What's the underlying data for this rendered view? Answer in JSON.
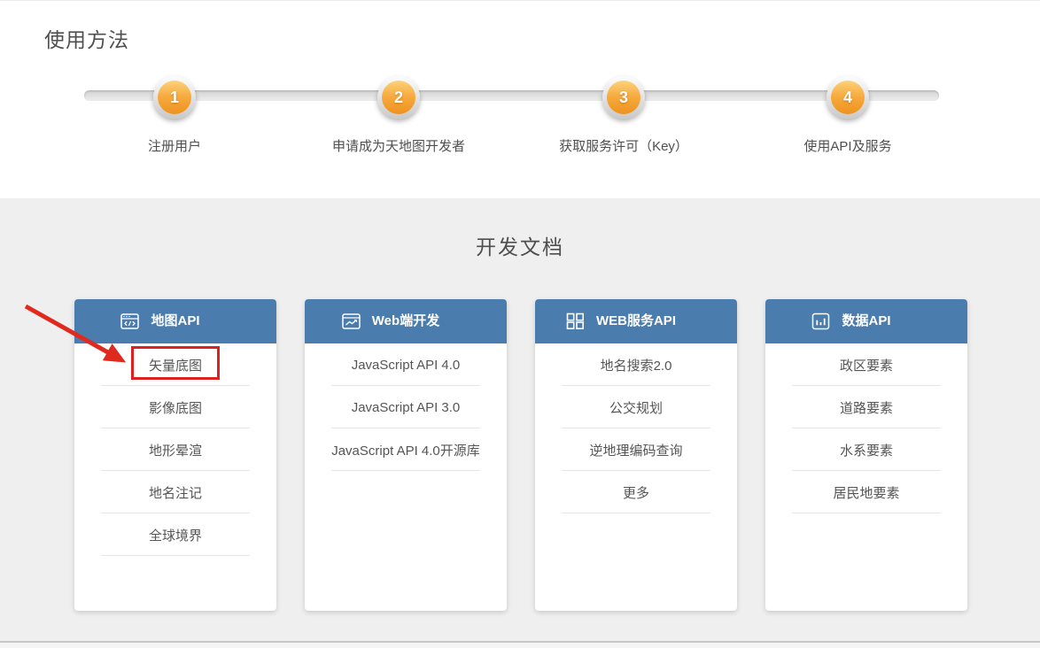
{
  "usage": {
    "title": "使用方法",
    "steps": [
      {
        "number": "1",
        "label": "注册用户"
      },
      {
        "number": "2",
        "label": "申请成为天地图开发者"
      },
      {
        "number": "3",
        "label": "获取服务许可（Key）"
      },
      {
        "number": "4",
        "label": "使用API及服务"
      }
    ]
  },
  "docs": {
    "title": "开发文档",
    "cards": [
      {
        "icon": "code-window-icon",
        "title": "地图API",
        "items": [
          "矢量底图",
          "影像底图",
          "地形晕渲",
          "地名注记",
          "全球境界"
        ],
        "highlighted_item": "矢量底图"
      },
      {
        "icon": "chart-window-icon",
        "title": "Web端开发",
        "items": [
          "JavaScript API 4.0",
          "JavaScript API 3.0",
          "JavaScript API 4.0开源库"
        ]
      },
      {
        "icon": "grid-icon",
        "title": "WEB服务API",
        "items": [
          "地名搜索2.0",
          "公交规划",
          "逆地理编码查询",
          "更多"
        ]
      },
      {
        "icon": "bar-chart-icon",
        "title": "数据API",
        "items": [
          "政区要素",
          "道路要素",
          "水系要素",
          "居民地要素"
        ]
      }
    ]
  },
  "colors": {
    "card_header_blue": "#4b7cae",
    "step_orange": "#f19a2b",
    "annotation_red": "#dd2120",
    "section_gray": "#efefef"
  }
}
